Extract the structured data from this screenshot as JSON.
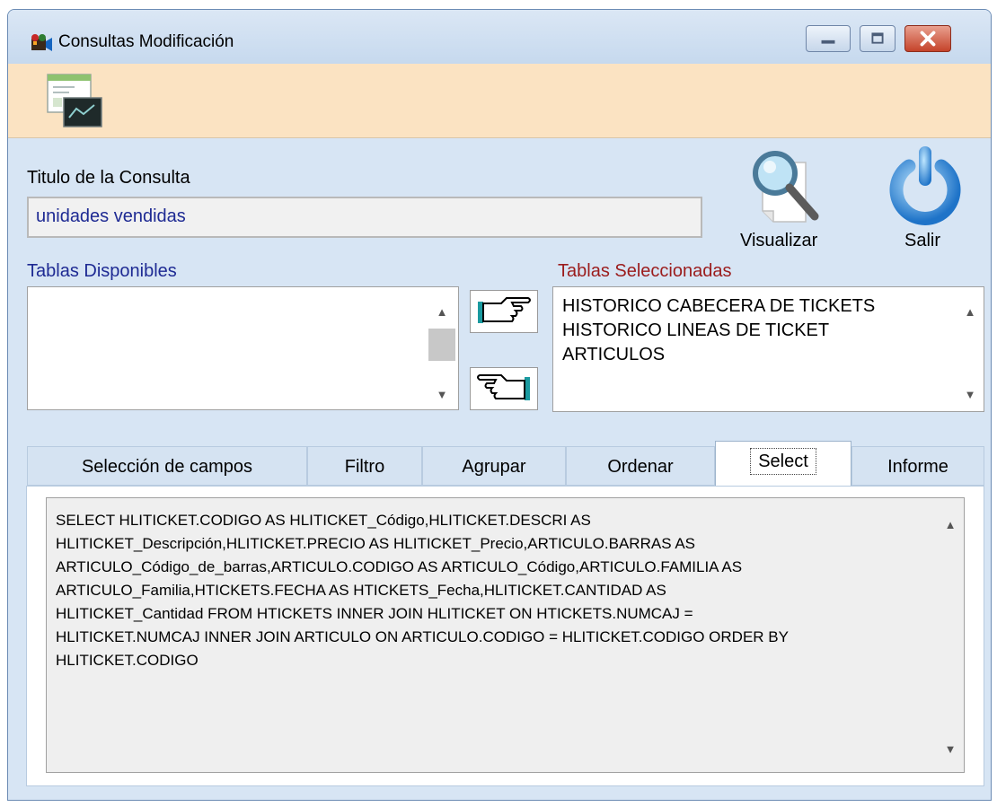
{
  "window": {
    "title": "Consultas Modificación",
    "title_icon": "movie-camera-icon",
    "controls": [
      "minimize-icon",
      "maximize-icon",
      "close-icon"
    ]
  },
  "toolbar": {
    "report_icon": "report-preview-icon"
  },
  "query_title": {
    "label": "Titulo de la Consulta",
    "value": "unidades vendidas"
  },
  "actions": {
    "preview_label": "Visualizar",
    "preview_icon": "magnifier-icon",
    "exit_label": "Salir",
    "exit_icon": "power-icon"
  },
  "available_tables": {
    "label": "Tablas Disponibles",
    "label_color": "#1e2a93",
    "items": []
  },
  "transfer": {
    "add_icon": "hand-pointing-right-icon",
    "remove_icon": "hand-pointing-left-icon"
  },
  "selected_tables": {
    "label": "Tablas Seleccionadas",
    "label_color": "#9b1c1c",
    "items": [
      "HISTORICO CABECERA DE TICKETS",
      "HISTORICO LINEAS DE TICKET",
      "ARTICULOS"
    ]
  },
  "tabs": [
    {
      "label": "Selección de campos",
      "active": false
    },
    {
      "label": "Filtro",
      "active": false
    },
    {
      "label": "Agrupar",
      "active": false
    },
    {
      "label": "Ordenar",
      "active": false
    },
    {
      "label": "Select",
      "active": true
    },
    {
      "label": "Informe",
      "active": false
    }
  ],
  "select_tab": {
    "sql_lines": [
      "SELECT HLITICKET.CODIGO AS HLITICKET_Código,HLITICKET.DESCRI AS",
      "HLITICKET_Descripción,HLITICKET.PRECIO AS HLITICKET_Precio,ARTICULO.BARRAS AS",
      "ARTICULO_Código_de_barras,ARTICULO.CODIGO AS ARTICULO_Código,ARTICULO.FAMILIA AS",
      "ARTICULO_Familia,HTICKETS.FECHA AS HTICKETS_Fecha,HLITICKET.CANTIDAD AS",
      "HLITICKET_Cantidad FROM HTICKETS INNER JOIN HLITICKET  ON HTICKETS.NUMCAJ =",
      "HLITICKET.NUMCAJ INNER JOIN ARTICULO ON ARTICULO.CODIGO = HLITICKET.CODIGO ORDER BY",
      "HLITICKET.CODIGO"
    ]
  },
  "colors": {
    "window_bg": "#d7e5f4",
    "toolbar_bg": "#fbe3c2",
    "input_text": "#1e2a93"
  }
}
